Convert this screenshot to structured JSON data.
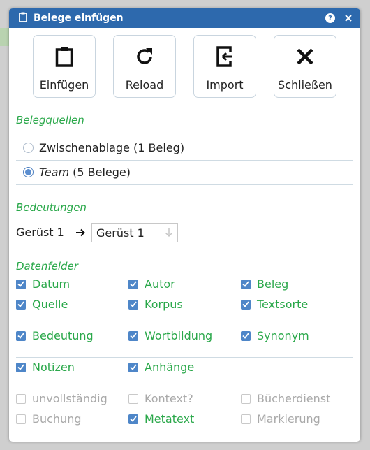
{
  "dialog": {
    "title": "Belege einfügen",
    "help_icon": "question-circle-icon",
    "close_icon": "close-icon"
  },
  "toolbar": [
    {
      "name": "einfuegen",
      "label": "Einfügen",
      "icon": "clipboard-icon"
    },
    {
      "name": "reload",
      "label": "Reload",
      "icon": "reload-icon"
    },
    {
      "name": "import",
      "label": "Import",
      "icon": "import-icon"
    },
    {
      "name": "schliessen",
      "label": "Schließen",
      "icon": "x-icon"
    }
  ],
  "belegquellen": {
    "title": "Belegquellen",
    "options": [
      {
        "label": "Zwischenablage (1 Beleg)",
        "selected": false
      },
      {
        "label_italic": "Team",
        "label_rest": " (5 Belege)",
        "selected": true
      }
    ]
  },
  "bedeutungen": {
    "title": "Bedeutungen",
    "source": "Gerüst 1",
    "target": "Gerüst 1"
  },
  "datenfelder": {
    "title": "Datenfelder",
    "fields": [
      {
        "label": "Datum",
        "checked": true
      },
      {
        "label": "Autor",
        "checked": true
      },
      {
        "label": "Beleg",
        "checked": true
      },
      {
        "label": "Quelle",
        "checked": true
      },
      {
        "label": "Korpus",
        "checked": true
      },
      {
        "label": "Textsorte",
        "checked": true
      },
      {
        "label": "Bedeutung",
        "checked": true
      },
      {
        "label": "Wortbildung",
        "checked": true
      },
      {
        "label": "Synonym",
        "checked": true
      },
      {
        "label": "Notizen",
        "checked": true
      },
      {
        "label": "Anhänge",
        "checked": true
      },
      {
        "label": "unvollständig",
        "checked": false
      },
      {
        "label": "Kontext?",
        "checked": false
      },
      {
        "label": "Bücherdienst",
        "checked": false
      },
      {
        "label": "Buchung",
        "checked": false
      },
      {
        "label": "Metatext",
        "checked": true
      },
      {
        "label": "Markierung",
        "checked": false
      }
    ]
  },
  "colors": {
    "titlebar": "#2d69ad",
    "accent_green": "#2aa84a",
    "checkbox_blue": "#4e86c8",
    "disabled_gray": "#a9a9a9"
  }
}
